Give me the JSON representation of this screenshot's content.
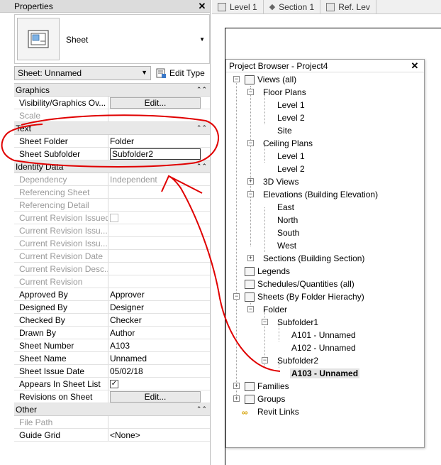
{
  "properties": {
    "title": "Properties",
    "type_name": "Sheet",
    "instance_selector": "Sheet: Unnamed",
    "edit_type_label": "Edit Type",
    "groups": {
      "graphics": "Graphics",
      "text": "Text",
      "identity": "Identity Data",
      "other": "Other"
    },
    "rows": {
      "vis_graphics": {
        "key": "Visibility/Graphics Ov...",
        "value": "Edit..."
      },
      "scale": {
        "key": "Scale",
        "value": ""
      },
      "sheet_folder": {
        "key": "Sheet Folder",
        "value": "Folder"
      },
      "sheet_subfolder": {
        "key": "Sheet Subfolder",
        "value": "Subfolder2"
      },
      "dependency": {
        "key": "Dependency",
        "value": "Independent"
      },
      "referencing_sheet": {
        "key": "Referencing Sheet",
        "value": ""
      },
      "referencing_detail": {
        "key": "Referencing Detail",
        "value": ""
      },
      "current_revision_issued": {
        "key": "Current Revision Issued",
        "value": ""
      },
      "current_revision_issued_by": {
        "key": "Current Revision Issu...",
        "value": ""
      },
      "current_revision_issued_to": {
        "key": "Current Revision Issu...",
        "value": ""
      },
      "current_revision_date": {
        "key": "Current Revision Date",
        "value": ""
      },
      "current_revision_desc": {
        "key": "Current Revision Desc...",
        "value": ""
      },
      "current_revision": {
        "key": "Current Revision",
        "value": ""
      },
      "approved_by": {
        "key": "Approved By",
        "value": "Approver"
      },
      "designed_by": {
        "key": "Designed By",
        "value": "Designer"
      },
      "checked_by": {
        "key": "Checked By",
        "value": "Checker"
      },
      "drawn_by": {
        "key": "Drawn By",
        "value": "Author"
      },
      "sheet_number": {
        "key": "Sheet Number",
        "value": "A103"
      },
      "sheet_name": {
        "key": "Sheet Name",
        "value": "Unnamed"
      },
      "sheet_issue_date": {
        "key": "Sheet Issue Date",
        "value": "05/02/18"
      },
      "appears_in_sheet_list": {
        "key": "Appears In Sheet List",
        "checked": true
      },
      "revisions_on_sheet": {
        "key": "Revisions on Sheet",
        "value": "Edit..."
      },
      "file_path": {
        "key": "File Path",
        "value": ""
      },
      "guide_grid": {
        "key": "Guide Grid",
        "value": "<None>"
      }
    }
  },
  "tabs": [
    "Level 1",
    "Section 1",
    "Ref. Lev"
  ],
  "project_browser": {
    "title": "Project Browser - Project4",
    "nodes": {
      "views": "Views (all)",
      "floor_plans": "Floor Plans",
      "fp_level1": "Level 1",
      "fp_level2": "Level 2",
      "fp_site": "Site",
      "ceiling_plans": "Ceiling Plans",
      "cp_level1": "Level 1",
      "cp_level2": "Level 2",
      "views_3d": "3D Views",
      "elevations": "Elevations (Building Elevation)",
      "el_east": "East",
      "el_north": "North",
      "el_south": "South",
      "el_west": "West",
      "sections": "Sections (Building Section)",
      "legends": "Legends",
      "schedules": "Schedules/Quantities (all)",
      "sheets": "Sheets (By Folder Hierachy)",
      "folder": "Folder",
      "subfolder1": "Subfolder1",
      "a101": "A101 - Unnamed",
      "a102": "A102 - Unnamed",
      "subfolder2": "Subfolder2",
      "a103": "A103 - Unnamed",
      "families": "Families",
      "groups": "Groups",
      "revit_links": "Revit Links"
    }
  },
  "annotation_color": "#e00000"
}
